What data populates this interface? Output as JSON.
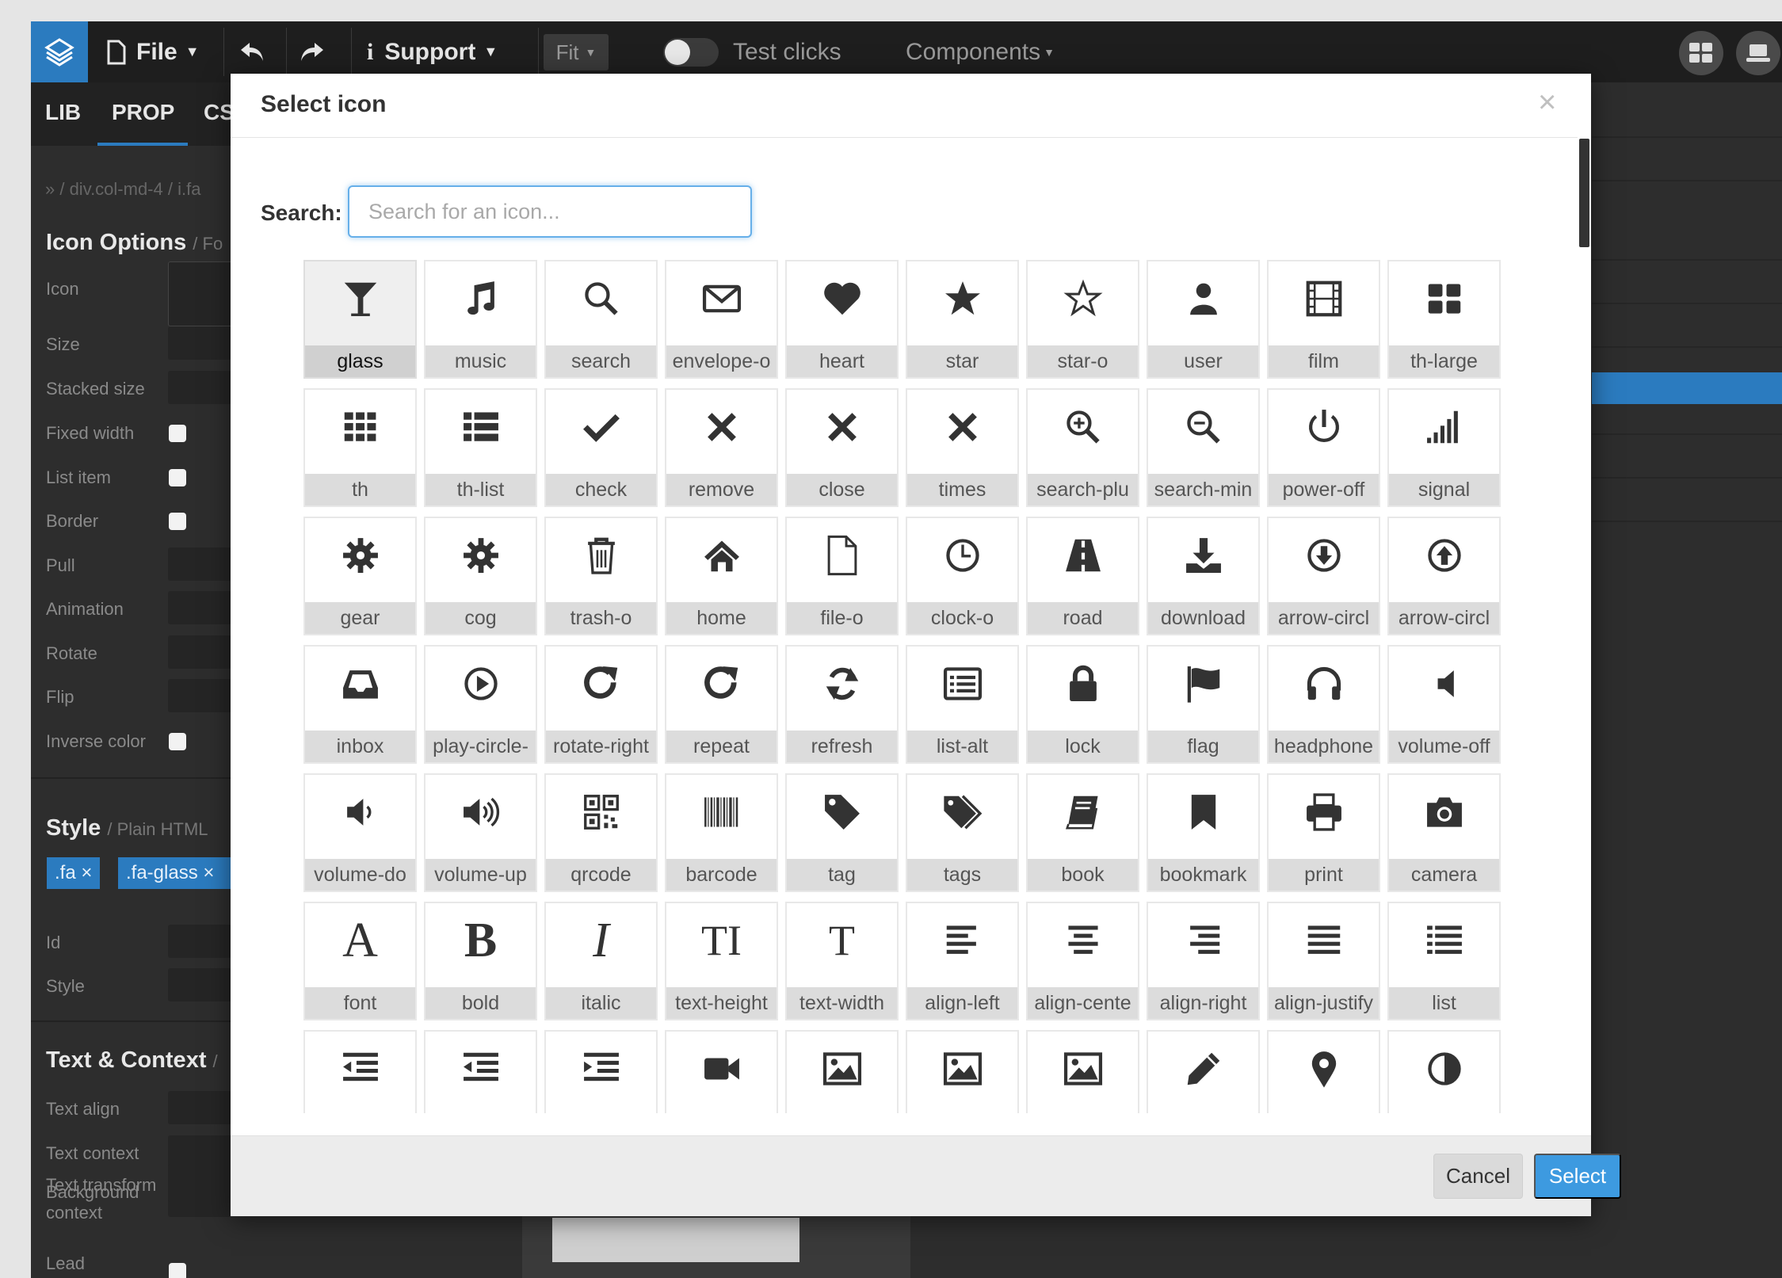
{
  "topbar": {
    "file_label": "File",
    "support_label": "Support",
    "fit_label": "Fit",
    "test_clicks_label": "Test clicks",
    "components_label": "Components"
  },
  "left_panel": {
    "tabs": [
      "LIB",
      "PROP",
      "CS"
    ],
    "breadcrumb": "» / div.col-md-4 / i.fa",
    "icon_options_title": "Icon Options",
    "icon_options_sub": "/ Fo",
    "fields": {
      "icon": "Icon",
      "size": "Size",
      "stacked_size": "Stacked size",
      "fixed_width": "Fixed width",
      "list_item": "List item",
      "border": "Border",
      "pull": "Pull",
      "animation": "Animation",
      "rotate": "Rotate",
      "flip": "Flip",
      "inverse_color": "Inverse color"
    },
    "style_title": "Style",
    "style_sub": "/ Plain HTML",
    "class_tags": [
      ".fa ×",
      ".fa-glass ×"
    ],
    "id_label": "Id",
    "style_label": "Style",
    "text_context_title": "Text & Context",
    "text_context_sub": "/",
    "text_fields": {
      "text_align": "Text align",
      "text_context": "Text context",
      "background_context": "Background context",
      "text_transform": "Text transform",
      "lead": "Lead"
    }
  },
  "modal": {
    "title": "Select icon",
    "close_glyph": "×",
    "search_label": "Search:",
    "search_placeholder": "Search for an icon...",
    "search_value": "",
    "cancel_label": "Cancel",
    "select_label": "Select",
    "selected_icon": "glass",
    "icons": [
      {
        "name": "glass",
        "label": "glass"
      },
      {
        "name": "music",
        "label": "music"
      },
      {
        "name": "search",
        "label": "search"
      },
      {
        "name": "envelope-o",
        "label": "envelope-o"
      },
      {
        "name": "heart",
        "label": "heart"
      },
      {
        "name": "star",
        "label": "star"
      },
      {
        "name": "star-o",
        "label": "star-o"
      },
      {
        "name": "user",
        "label": "user"
      },
      {
        "name": "film",
        "label": "film"
      },
      {
        "name": "th-large",
        "label": "th-large"
      },
      {
        "name": "th",
        "label": "th"
      },
      {
        "name": "th-list",
        "label": "th-list"
      },
      {
        "name": "check",
        "label": "check"
      },
      {
        "name": "remove",
        "label": "remove"
      },
      {
        "name": "close",
        "label": "close"
      },
      {
        "name": "times",
        "label": "times"
      },
      {
        "name": "search-plus",
        "label": "search-plu"
      },
      {
        "name": "search-minus",
        "label": "search-min"
      },
      {
        "name": "power-off",
        "label": "power-off"
      },
      {
        "name": "signal",
        "label": "signal"
      },
      {
        "name": "gear",
        "label": "gear"
      },
      {
        "name": "cog",
        "label": "cog"
      },
      {
        "name": "trash-o",
        "label": "trash-o"
      },
      {
        "name": "home",
        "label": "home"
      },
      {
        "name": "file-o",
        "label": "file-o"
      },
      {
        "name": "clock-o",
        "label": "clock-o"
      },
      {
        "name": "road",
        "label": "road"
      },
      {
        "name": "download",
        "label": "download"
      },
      {
        "name": "arrow-circle-down",
        "label": "arrow-circl"
      },
      {
        "name": "arrow-circle-up",
        "label": "arrow-circl"
      },
      {
        "name": "inbox",
        "label": "inbox"
      },
      {
        "name": "play-circle",
        "label": "play-circle-"
      },
      {
        "name": "rotate-right",
        "label": "rotate-right"
      },
      {
        "name": "repeat",
        "label": "repeat"
      },
      {
        "name": "refresh",
        "label": "refresh"
      },
      {
        "name": "list-alt",
        "label": "list-alt"
      },
      {
        "name": "lock",
        "label": "lock"
      },
      {
        "name": "flag",
        "label": "flag"
      },
      {
        "name": "headphones",
        "label": "headphone"
      },
      {
        "name": "volume-off",
        "label": "volume-off"
      },
      {
        "name": "volume-down",
        "label": "volume-do"
      },
      {
        "name": "volume-up",
        "label": "volume-up"
      },
      {
        "name": "qrcode",
        "label": "qrcode"
      },
      {
        "name": "barcode",
        "label": "barcode"
      },
      {
        "name": "tag",
        "label": "tag"
      },
      {
        "name": "tags",
        "label": "tags"
      },
      {
        "name": "book",
        "label": "book"
      },
      {
        "name": "bookmark",
        "label": "bookmark"
      },
      {
        "name": "print",
        "label": "print"
      },
      {
        "name": "camera",
        "label": "camera"
      },
      {
        "name": "font",
        "label": "font"
      },
      {
        "name": "bold",
        "label": "bold"
      },
      {
        "name": "italic",
        "label": "italic"
      },
      {
        "name": "text-height",
        "label": "text-height"
      },
      {
        "name": "text-width",
        "label": "text-width"
      },
      {
        "name": "align-left",
        "label": "align-left"
      },
      {
        "name": "align-center",
        "label": "align-cente"
      },
      {
        "name": "align-right",
        "label": "align-right"
      },
      {
        "name": "align-justify",
        "label": "align-justify"
      },
      {
        "name": "list",
        "label": "list"
      },
      {
        "name": "outdent",
        "label": ""
      },
      {
        "name": "dedent",
        "label": ""
      },
      {
        "name": "indent",
        "label": ""
      },
      {
        "name": "video-camera",
        "label": ""
      },
      {
        "name": "image",
        "label": ""
      },
      {
        "name": "photo",
        "label": ""
      },
      {
        "name": "picture-o",
        "label": ""
      },
      {
        "name": "pencil",
        "label": ""
      },
      {
        "name": "map-marker",
        "label": ""
      },
      {
        "name": "adjust",
        "label": ""
      }
    ]
  },
  "colors": {
    "accent": "#2b7bbf",
    "select_button": "#3d9ae0",
    "topbar": "#1e1e1e",
    "panel": "#2d2d2d"
  }
}
